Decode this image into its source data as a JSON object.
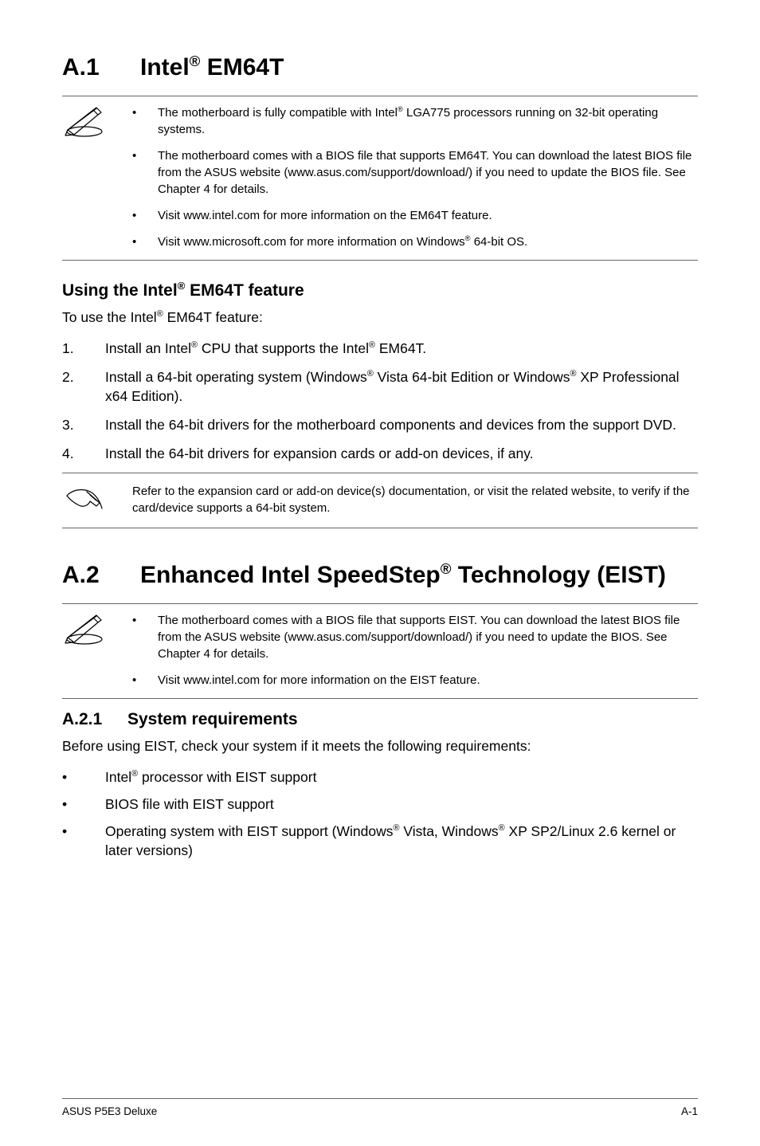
{
  "section1": {
    "number": "A.1",
    "title_pre": "Intel",
    "title_reg": "®",
    "title_post": " EM64T",
    "notes": [
      {
        "pre": "The motherboard is fully compatible with Intel",
        "sup": "®",
        "post": " LGA775 processors running on 32-bit operating systems."
      },
      {
        "text": "The motherboard comes with a BIOS file that supports EM64T. You can download the latest BIOS file from the ASUS website (www.asus.com/support/download/) if you need to update the BIOS file. See Chapter 4 for details."
      },
      {
        "text": "Visit www.intel.com for more information on the EM64T feature."
      },
      {
        "pre": "Visit www.microsoft.com for more information on Windows",
        "sup": "®",
        "post": " 64-bit OS."
      }
    ],
    "subhead_pre": "Using the Intel",
    "subhead_reg": "®",
    "subhead_post": " EM64T feature",
    "intro_pre": "To use the Intel",
    "intro_sup": "®",
    "intro_post": " EM64T feature:",
    "steps": [
      {
        "n": "1.",
        "pre": "Install an Intel",
        "sup1": "®",
        "mid": " CPU that supports the Intel",
        "sup2": "®",
        "post": " EM64T."
      },
      {
        "n": "2.",
        "pre": "Install a 64-bit operating system (Windows",
        "sup1": "®",
        "mid": " Vista 64-bit Edition or Windows",
        "sup2": "®",
        "post": " XP Professional x64 Edition)."
      },
      {
        "n": "3.",
        "text": "Install the 64-bit drivers for the motherboard components and devices from the support DVD."
      },
      {
        "n": "4.",
        "text": "Install the 64-bit drivers for expansion cards or add-on devices, if any."
      }
    ],
    "tip": "Refer to the expansion card or add-on device(s) documentation, or visit the related website, to verify if the card/device supports a 64-bit system."
  },
  "section2": {
    "number": "A.2",
    "title_pre": "Enhanced Intel SpeedStep",
    "title_reg": "®",
    "title_post": " Technology (EIST)",
    "notes": [
      {
        "text": "The motherboard comes with a BIOS file that supports EIST. You can download the latest BIOS file from the ASUS website (www.asus.com/support/download/) if you need to update the BIOS. See Chapter 4 for details."
      },
      {
        "text": "Visit www.intel.com for more information on the EIST feature."
      }
    ],
    "sub_num": "A.2.1",
    "sub_title": "System requirements",
    "sub_intro": "Before using EIST, check your system if it meets the following requirements:",
    "bullets": [
      {
        "pre": "Intel",
        "sup": "®",
        "post": " processor with EIST support"
      },
      {
        "text": "BIOS file with EIST support"
      },
      {
        "pre": "Operating system with EIST support (Windows",
        "sup1": "®",
        "mid": " Vista, Windows",
        "sup2": "®",
        "post": " XP SP2/Linux 2.6 kernel or later versions)"
      }
    ]
  },
  "footer": {
    "left": "ASUS P5E3 Deluxe",
    "right": "A-1"
  },
  "glyphs": {
    "bullet": "•"
  }
}
